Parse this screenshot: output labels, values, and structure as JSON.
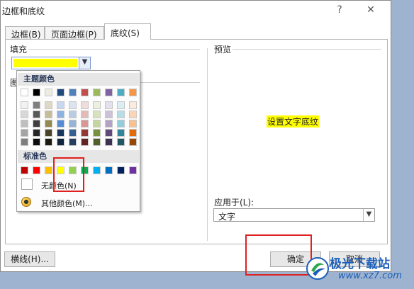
{
  "window": {
    "title": "边框和底纹",
    "help_icon": "?",
    "close_icon": "✕"
  },
  "tabs": [
    {
      "label": "边框(B)"
    },
    {
      "label": "页面边框(P)"
    },
    {
      "label": "底纹(S)"
    }
  ],
  "fill": {
    "label": "填充",
    "selected_color": "#ffff00"
  },
  "pattern_label_partial": "图",
  "palette": {
    "theme_header": "主题颜色",
    "standard_header": "标准色",
    "no_color_label": "无颜色(N)",
    "more_colors_label": "其他颜色(M)...",
    "theme_top": [
      "#ffffff",
      "#000000",
      "#eeece1",
      "#1f497d",
      "#4f81bd",
      "#c0504d",
      "#9bbb59",
      "#8064a2",
      "#4bacc6",
      "#f79646"
    ],
    "theme_shades": [
      [
        "#f2f2f2",
        "#7f7f7f",
        "#ddd9c3",
        "#c6d9f0",
        "#dbe5f1",
        "#f2dcdb",
        "#ebf1dd",
        "#e5e0ec",
        "#dbeef3",
        "#fdeada"
      ],
      [
        "#d8d8d8",
        "#595959",
        "#c4bd97",
        "#8db3e2",
        "#b8cce4",
        "#e5b9b7",
        "#d7e3bc",
        "#ccc1d9",
        "#b7dde8",
        "#fbd5b5"
      ],
      [
        "#bfbfbf",
        "#3f3f3f",
        "#938953",
        "#548dd4",
        "#95b3d7",
        "#d99694",
        "#c3d69b",
        "#b2a2c7",
        "#92cddc",
        "#fac08f"
      ],
      [
        "#a5a5a5",
        "#262626",
        "#494429",
        "#17365d",
        "#366092",
        "#953734",
        "#76923c",
        "#5f497a",
        "#31859b",
        "#e36c09"
      ],
      [
        "#7f7f7f",
        "#0c0c0c",
        "#1d1b10",
        "#0f243e",
        "#244061",
        "#632423",
        "#4f6128",
        "#3f3151",
        "#205867",
        "#974806"
      ]
    ],
    "standard": [
      "#c00000",
      "#ff0000",
      "#ffc000",
      "#ffff00",
      "#92d050",
      "#00b050",
      "#00b0f0",
      "#0070c0",
      "#002060",
      "#7030a0"
    ],
    "highlight_color": "#e02020"
  },
  "preview": {
    "label": "预览",
    "sample_text": "设置文字底纹"
  },
  "apply_to": {
    "label": "应用于(L):",
    "value": "文字"
  },
  "buttons": {
    "lines": "横线(H)...",
    "ok": "确定",
    "cancel": "取消"
  },
  "watermark": {
    "text": "极光下载站",
    "url": "www.xz7.com"
  }
}
